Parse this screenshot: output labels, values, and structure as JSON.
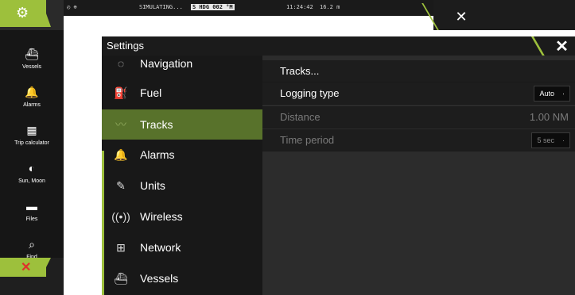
{
  "status_bar": {
    "text1": "SIMULATING...",
    "text2": "S HDG 002 °M",
    "time": "11:24:42",
    "speed": "16.2 m"
  },
  "sidebar": {
    "items": [
      {
        "label": "Vessels",
        "icon": "vessel-icon"
      },
      {
        "label": "Alarms",
        "icon": "bell-icon"
      },
      {
        "label": "Trip calculator",
        "icon": "calculator-icon"
      },
      {
        "label": "Sun, Moon",
        "icon": "sun-moon-icon"
      },
      {
        "label": "Files",
        "icon": "folder-icon"
      },
      {
        "label": "Find",
        "icon": "search-icon"
      }
    ]
  },
  "dialog": {
    "title": "Settings",
    "menu": [
      {
        "label": "Navigation",
        "icon": "compass-icon"
      },
      {
        "label": "Fuel",
        "icon": "fuel-icon"
      },
      {
        "label": "Tracks",
        "icon": "tracks-icon",
        "active": true
      },
      {
        "label": "Alarms",
        "icon": "bell-icon"
      },
      {
        "label": "Units",
        "icon": "pencil-icon"
      },
      {
        "label": "Wireless",
        "icon": "wireless-icon"
      },
      {
        "label": "Network",
        "icon": "network-icon"
      },
      {
        "label": "Vessels",
        "icon": "vessel-icon"
      }
    ],
    "content": {
      "tracks_label": "Tracks...",
      "logging_type_label": "Logging type",
      "logging_type_value": "Auto",
      "distance_label": "Distance",
      "distance_value": "1.00 NM",
      "time_period_label": "Time period",
      "time_period_value": "5 sec"
    }
  },
  "colors": {
    "accent": "#9dc03c",
    "active_menu": "#58722b"
  }
}
